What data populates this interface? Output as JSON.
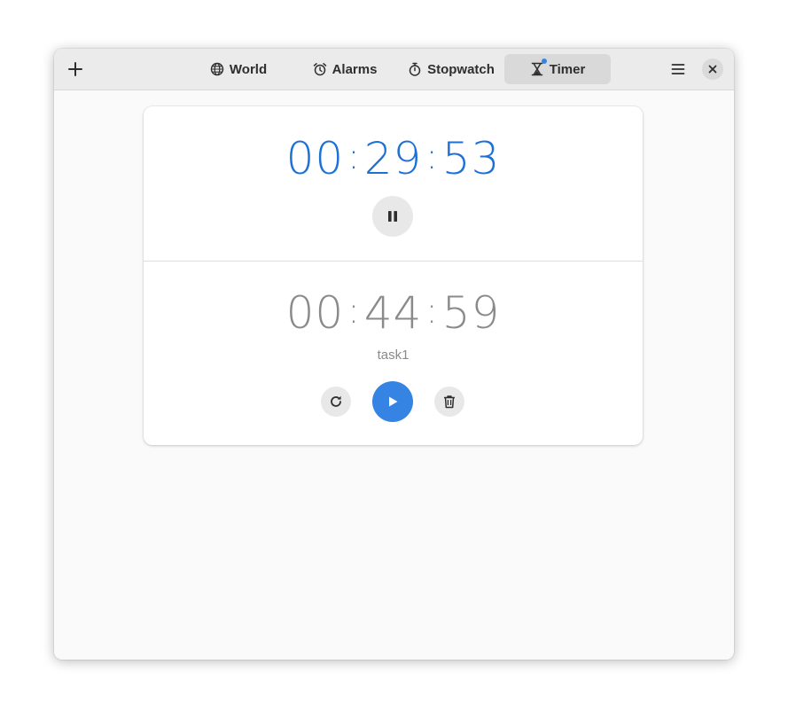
{
  "header": {
    "add_icon": "plus-icon",
    "tabs": [
      {
        "label": "World",
        "icon": "globe-icon",
        "active": false
      },
      {
        "label": "Alarms",
        "icon": "alarm-clock-icon",
        "active": false
      },
      {
        "label": "Stopwatch",
        "icon": "stopwatch-icon",
        "active": false
      },
      {
        "label": "Timer",
        "icon": "hourglass-icon",
        "active": true,
        "indicator_dot": true
      }
    ],
    "menu_icon": "hamburger-menu-icon",
    "close_icon": "close-icon"
  },
  "timers": [
    {
      "state": "running",
      "hours": "00",
      "minutes": "29",
      "seconds": "53",
      "separator": ":",
      "controls": [
        "pause"
      ]
    },
    {
      "state": "paused",
      "hours": "00",
      "minutes": "44",
      "seconds": "59",
      "separator": ":",
      "name": "task1",
      "controls": [
        "reset",
        "play",
        "delete"
      ]
    }
  ],
  "colors": {
    "accent": "#3584e4",
    "running_time": "#1c71d8",
    "paused_time": "#8a8a8a",
    "headerbar": "#ebebeb",
    "window_bg": "#fafafa"
  }
}
